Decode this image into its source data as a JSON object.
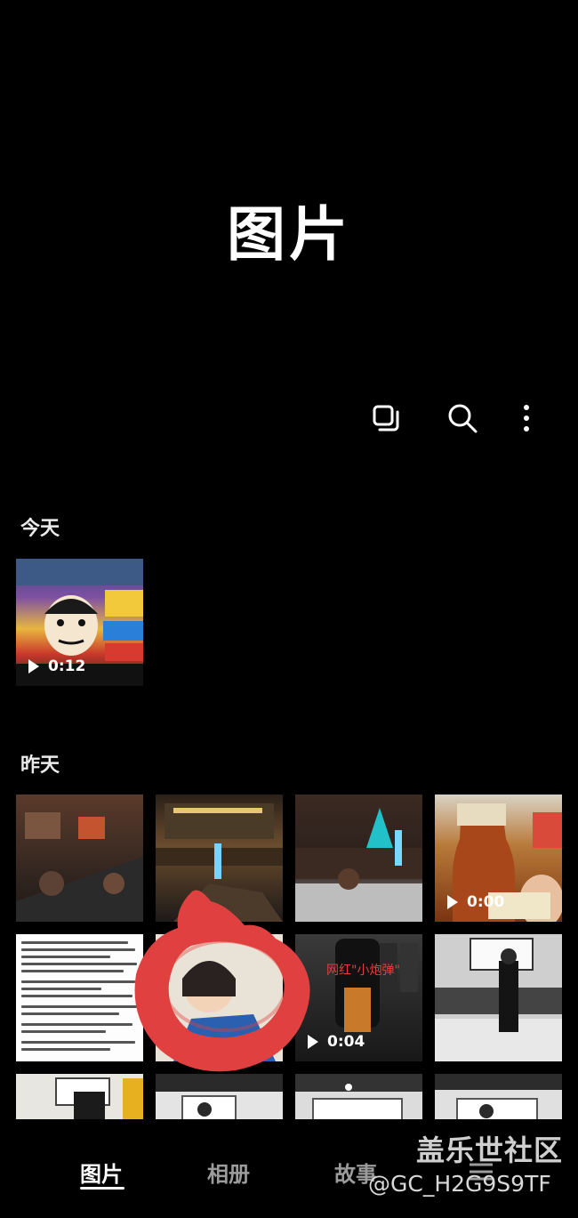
{
  "header": {
    "title": "图片"
  },
  "toolbar": {
    "select_icon": "select-multiple-icon",
    "search_icon": "search-icon",
    "more_icon": "more-vertical-icon"
  },
  "sections": [
    {
      "label": "今天",
      "items": [
        {
          "duration": "0:12"
        }
      ]
    },
    {
      "label": "昨天",
      "items": [
        {
          "duration": ""
        },
        {
          "duration": ""
        },
        {
          "duration": ""
        },
        {
          "duration": "0:00"
        },
        {
          "duration": ""
        },
        {
          "duration": ""
        },
        {
          "duration": "0:04"
        },
        {
          "duration": ""
        }
      ]
    }
  ],
  "embedded_text": {
    "overlay_caption": "网红\"小炮弹\""
  },
  "bottom_nav": {
    "items": [
      {
        "label": "图片"
      },
      {
        "label": "相册"
      },
      {
        "label": "故事"
      }
    ],
    "active_index": 0
  },
  "watermark": {
    "line1": "盖乐世社区",
    "line2": "@GC_H2G9S9TF"
  },
  "annotation": {
    "circle_color": "#e0403f"
  }
}
